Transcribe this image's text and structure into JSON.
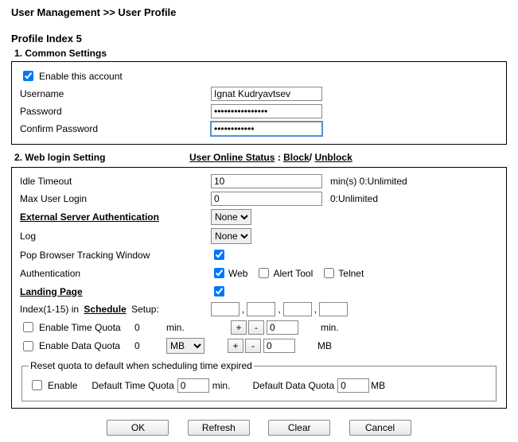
{
  "breadcrumb": {
    "a": "User Management",
    "sep": ">>",
    "b": "User Profile"
  },
  "profile_head": "Profile Index 5",
  "sections": {
    "common_title": "1. Common Settings",
    "web_title": "2. Web login Setting"
  },
  "common": {
    "enable_label": "Enable this account",
    "enable_checked": true,
    "username_label": "Username",
    "username_value": "Ignat Kudryavtsev",
    "password_label": "Password",
    "password_value": "••••••••••••••••",
    "confirm_label": "Confirm Password",
    "confirm_value": "••••••••••••"
  },
  "web": {
    "online_status_label": "User Online Status",
    "sep": ":",
    "block": "Block",
    "slash": "/",
    "unblock": "Unblock",
    "idle_label": "Idle Timeout",
    "idle_value": "10",
    "idle_suffix": "min(s) 0:Unlimited",
    "max_label": "Max User Login",
    "max_value": "0",
    "max_suffix": "0:Unlimited",
    "ext_auth_label": "External Server Authentication",
    "ext_auth_value": "None",
    "log_label": "Log",
    "log_value": "None",
    "pop_label": "Pop Browser Tracking Window",
    "pop_checked": true,
    "auth_label": "Authentication",
    "auth_web": "Web",
    "auth_web_checked": true,
    "auth_alert": "Alert Tool",
    "auth_alert_checked": false,
    "auth_telnet": "Telnet",
    "auth_telnet_checked": false,
    "landing_label": "Landing Page",
    "landing_checked": true,
    "index_pre": "Index(1-15) in",
    "schedule": "Schedule",
    "index_post": "Setup:",
    "sched_vals": [
      "",
      "",
      "",
      ""
    ],
    "comma": ",",
    "time_quota_label": "Enable Time Quota",
    "time_quota_checked": false,
    "time_quota_cur": "0",
    "time_quota_unit": "min.",
    "time_quota_val": "0",
    "plus": "+",
    "minus": "-",
    "data_quota_label": "Enable Data Quota",
    "data_quota_checked": false,
    "data_quota_cur": "0",
    "data_quota_unit": "MB",
    "data_quota_val": "0",
    "mb_suffix": "MB",
    "reset": {
      "legend": "Reset quota to default when scheduling time expired",
      "enable_label": "Enable",
      "enable_checked": false,
      "def_time_label": "Default Time Quota",
      "def_time_val": "0",
      "def_time_unit": "min.",
      "def_data_label": "Default Data Quota",
      "def_data_val": "0",
      "def_data_unit": "MB"
    }
  },
  "buttons": {
    "ok": "OK",
    "refresh": "Refresh",
    "clear": "Clear",
    "cancel": "Cancel"
  }
}
